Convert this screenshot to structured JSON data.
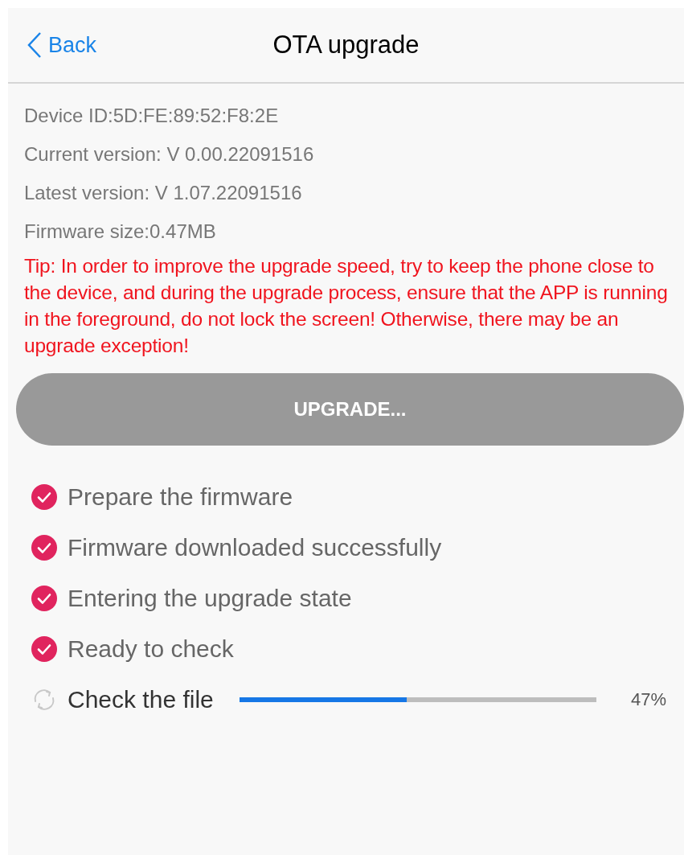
{
  "nav": {
    "back": "Back",
    "title": "OTA upgrade"
  },
  "info": [
    "Device ID:5D:FE:89:52:F8:2E",
    "Current version: V 0.00.22091516",
    "Latest version: V 1.07.22091516",
    "Firmware size:0.47MB"
  ],
  "tip": "Tip: In order to improve the upgrade speed, try to keep the phone close to the device, and during the upgrade process, ensure that the APP is running in the foreground, do not lock the screen! Otherwise, there may be an upgrade exception!",
  "upgrade_button": {
    "label": "UPGRADE...",
    "disabled": true
  },
  "steps": [
    {
      "label": "Prepare the firmware",
      "kind": "done"
    },
    {
      "label": "Firmware downloaded successfully",
      "kind": "done"
    },
    {
      "label": "Entering the upgrade state",
      "kind": "done"
    },
    {
      "label": "Ready to check",
      "kind": "done"
    },
    {
      "label": "Check the file",
      "kind": "progress",
      "level": 0.47,
      "reading": "47%"
    }
  ]
}
